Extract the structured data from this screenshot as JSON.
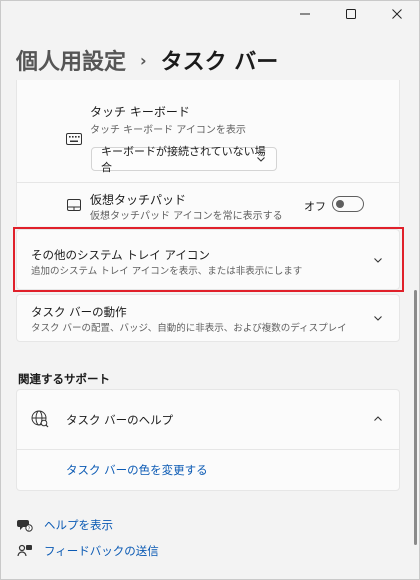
{
  "window": {
    "controls": {
      "minimize": "—",
      "maximize": "☐",
      "close": "✕"
    }
  },
  "breadcrumb": {
    "parent": "個人用設定",
    "separator": "›",
    "current": "タスク バー"
  },
  "touch_keyboard": {
    "title": "タッチ キーボード",
    "description": "タッチ キーボード アイコンを表示",
    "icon": "keyboard-icon",
    "dropdown_value": "キーボードが接続されていない場合"
  },
  "virtual_touchpad": {
    "title": "仮想タッチパッド",
    "description": "仮想タッチパッド アイコンを常に表示する",
    "icon": "touchpad-icon",
    "toggle_label": "オフ",
    "toggle_on": false
  },
  "other_tray_icons": {
    "title": "その他のシステム トレイ アイコン",
    "description": "追加のシステム トレイ アイコンを表示、または非表示にします",
    "highlight_color": "#e0202a"
  },
  "taskbar_behavior": {
    "title": "タスク バーの動作",
    "description": "タスク バーの配置、バッジ、自動的に非表示、および複数のディスプレイ"
  },
  "related_support": {
    "section_title": "関連するサポート",
    "help_title": "タスク バーのヘルプ",
    "help_link": "タスク バーの色を変更する"
  },
  "footer": {
    "get_help": "ヘルプを表示",
    "feedback": "フィードバックの送信"
  },
  "colors": {
    "background": "#f3f3f3",
    "card": "#fbfbfb",
    "link": "#0b5ab4"
  }
}
